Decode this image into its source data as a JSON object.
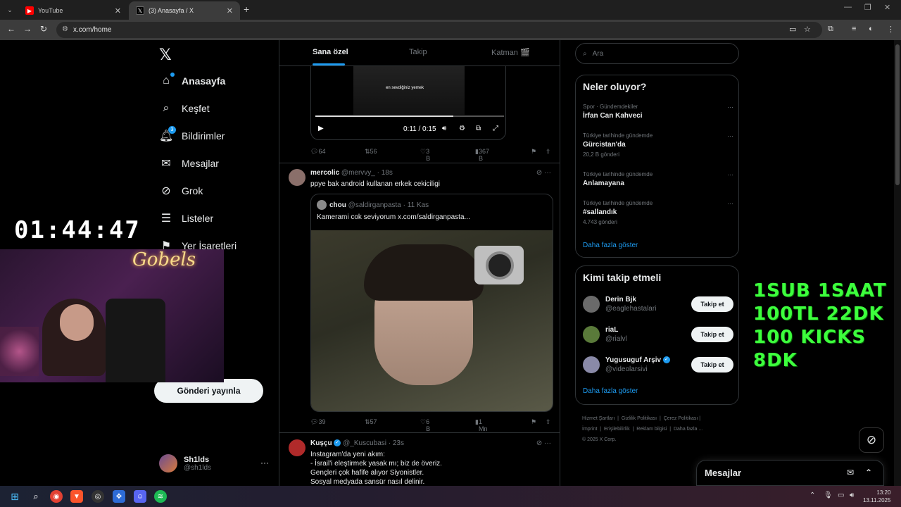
{
  "browser": {
    "tabs": [
      {
        "title": "YouTube",
        "active": false
      },
      {
        "title": "(3) Anasayfa / X",
        "active": true
      }
    ],
    "url": "x.com/home"
  },
  "sidebar": {
    "items": [
      {
        "label": "Anasayfa",
        "icon": "home-icon"
      },
      {
        "label": "Keşfet",
        "icon": "search-icon"
      },
      {
        "label": "Bildirimler",
        "icon": "bell-icon",
        "badge": "3"
      },
      {
        "label": "Mesajlar",
        "icon": "mail-icon"
      },
      {
        "label": "Grok",
        "icon": "grok-icon"
      },
      {
        "label": "Listeler",
        "icon": "list-icon"
      },
      {
        "label": "Yer İşaretleri",
        "icon": "bookmark-icon"
      }
    ],
    "post_button": "Gönderi yayınla",
    "profile": {
      "name": "Sh1lds",
      "handle": "@sh1lds"
    }
  },
  "stream_overlay": {
    "timer": "01:44:47",
    "neon_sign": "Gobels",
    "promo_lines": [
      "1SUB 1SAAT",
      "100TL 22DK",
      "100 KICKS 8DK"
    ]
  },
  "feed": {
    "tabs": [
      "Sana özel",
      "Takip",
      "Katman 🎬"
    ],
    "active_tab": 0,
    "video_post": {
      "caption": "en sevdiğiniz yemek",
      "time": "0:11 / 0:15",
      "progress": 0.73,
      "stats": {
        "replies": "64",
        "reposts": "56",
        "likes": "3 B",
        "views": "367 B"
      }
    },
    "posts": [
      {
        "name": "mercolic",
        "handle": "@mervvy_",
        "time": "· 18s",
        "text": "ppye bak android kullanan erkek cekiciligi",
        "quote": {
          "name": "chou",
          "handle": "@saldirganpasta",
          "time": "· 11 Kas",
          "text": "Kamerami cok seviyorum  x.com/saldirganpasta..."
        },
        "stats": {
          "replies": "39",
          "reposts": "57",
          "likes": "6 B",
          "views": "1 Mn"
        }
      },
      {
        "name": "Kuşçu",
        "handle": "@_Kuscubasi",
        "time": "· 23s",
        "verified": true,
        "lines": [
          "Instagram'da yeni akım:",
          "- İsrail'i eleştirmek yasak mı; biz de överiz.",
          "Gençleri çok hafife alıyor Siyonistler.",
          "Sosyal medyada sansür nasıl delinir."
        ]
      }
    ]
  },
  "right": {
    "search_placeholder": "Ara",
    "trends_title": "Neler oluyor?",
    "trends": [
      {
        "category": "Spor · Gündemdekiler",
        "name": "İrfan Can Kahveci",
        "count": ""
      },
      {
        "category": "Türkiye tarihinde gündemde",
        "name": "Gürcistan'da",
        "count": "20,2 B gönderi"
      },
      {
        "category": "Türkiye tarihinde gündemde",
        "name": "Anlamayana",
        "count": ""
      },
      {
        "category": "Türkiye tarihinde gündemde",
        "name": "#sallandık",
        "count": "4.743 gönderi"
      }
    ],
    "trends_more": "Daha fazla göster",
    "who_title": "Kimi takip etmeli",
    "who": [
      {
        "name": "Derin Bjk",
        "handle": "@eaglehastalari",
        "verified": false
      },
      {
        "name": "riaL",
        "handle": "@rialvl",
        "verified": false
      },
      {
        "name": "Yugusuguf Arşiv",
        "handle": "@videolarsivi",
        "verified": true
      }
    ],
    "follow_label": "Takip et",
    "who_more": "Daha fazla göster",
    "footer": [
      "Hizmet Şartları",
      "Gizlilik Politikası",
      "Çerez Politikası",
      "İmprint",
      "Erişilebilirlik",
      "Reklam bilgisi",
      "Daha fazla ...",
      "© 2025 X Corp."
    ],
    "messages_dock": "Mesajlar"
  },
  "taskbar": {
    "time": "13:20",
    "date": "13.11.2025"
  },
  "colors": {
    "accent": "#1d9bf0",
    "promo": "#3dff3d",
    "bg": "#000000"
  }
}
